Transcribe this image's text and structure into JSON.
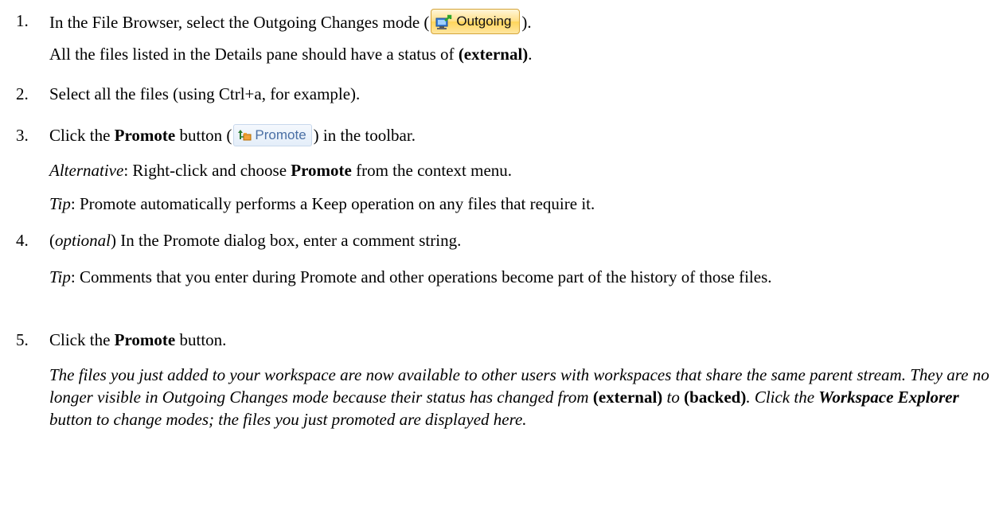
{
  "steps": [
    {
      "num": "1.",
      "pre": "In the File Browser, select the Outgoing Changes mode (",
      "button_label": "Outgoing",
      "post": ").",
      "note_pre": "All the files listed in the Details pane should have a status of ",
      "note_bold": "(external)",
      "note_post": "."
    },
    {
      "num": "2.",
      "text": "Select all the files (using Ctrl+a, for example)."
    },
    {
      "num": "3.",
      "pre": "Click the ",
      "bold": "Promote",
      "mid": " button (",
      "button_label": "Promote",
      "post": ") in the toolbar.",
      "alt_label": "Alternative",
      "alt_pre": ": Right-click and choose ",
      "alt_bold": "Promote",
      "alt_post": " from the context menu.",
      "tip_label": "Tip",
      "tip_text": ": Promote automatically performs a Keep operation on any files that require it."
    },
    {
      "num": "4.",
      "open": "(",
      "optional": "optional",
      "text": ") In the Promote dialog box, enter a comment string.",
      "tip_label": "Tip",
      "tip_text": ": Comments that you enter during Promote and other operations become part of the history of those files."
    },
    {
      "num": "5.",
      "pre": "Click the ",
      "bold": "Promote",
      "post": " button.",
      "result": {
        "a": "The files you just added to your workspace are now available to other users with workspaces that share the same parent stream. They are no longer visible in Outgoing Changes mode because their status has changed from ",
        "b1": "(external)",
        "c": " to ",
        "b2": "(backed)",
        "d": ". Click the ",
        "b3": "Workspace Explorer",
        "e": " button to change modes; the files you just promoted are displayed here."
      }
    }
  ],
  "icons": {
    "outgoing": "outgoing-computer-arrow-icon",
    "promote": "promote-icon"
  }
}
